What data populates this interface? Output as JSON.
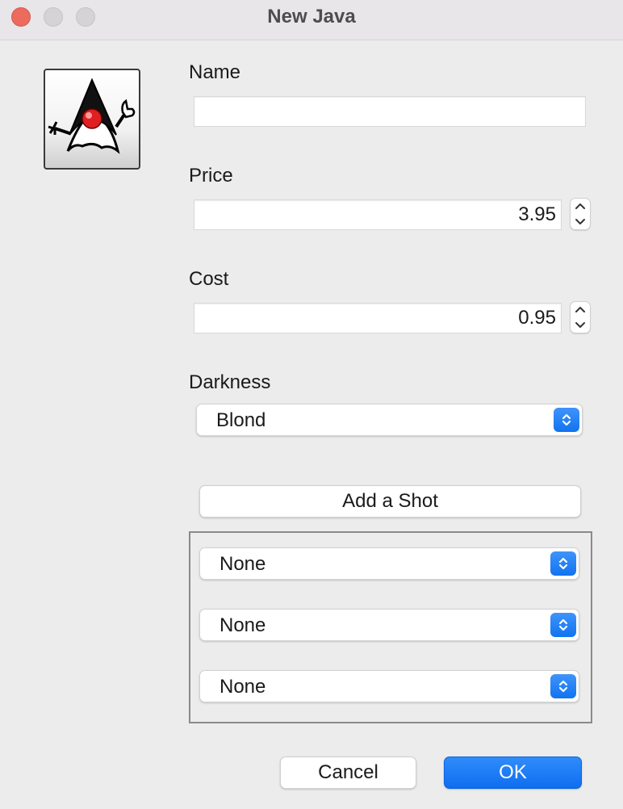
{
  "window": {
    "title": "New Java"
  },
  "icons": {
    "app_icon": "duke-mascot-icon",
    "stepper_up": "chevron-up-icon",
    "stepper_down": "chevron-down-icon",
    "popup_indicator": "up-down-chevron-icon"
  },
  "colors": {
    "accent": "#1a78f2",
    "close_button": "#ec6a5e",
    "window_background": "#ececec"
  },
  "form": {
    "name_label": "Name",
    "name_value": "",
    "price_label": "Price",
    "price_value": "3.95",
    "cost_label": "Cost",
    "cost_value": "0.95",
    "darkness_label": "Darkness",
    "darkness_value": "Blond"
  },
  "shots": {
    "add_button": "Add a Shot",
    "items": [
      "None",
      "None",
      "None"
    ]
  },
  "actions": {
    "cancel": "Cancel",
    "ok": "OK"
  }
}
